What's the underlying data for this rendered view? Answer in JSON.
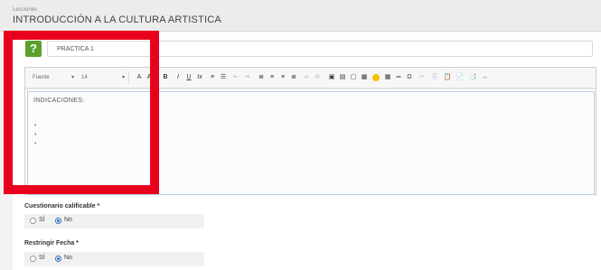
{
  "header": {
    "breadcrumb": "Lecciones",
    "title": "INTRODUCCIÓN A LA CULTURA ARTISTICA"
  },
  "question_icon": {
    "glyph": "?",
    "color": "#5aa02c"
  },
  "practice_name": {
    "value": "PRACTICA 1"
  },
  "toolbar": {
    "font_label": "Fuente",
    "size_label": "14",
    "buttons": [
      {
        "name": "font-color-icon",
        "glyph": "A"
      },
      {
        "name": "background-color-icon",
        "glyph": "A"
      },
      {
        "name": "bold-icon",
        "glyph": "B"
      },
      {
        "name": "italic-icon",
        "glyph": "I"
      },
      {
        "name": "underline-icon",
        "glyph": "U"
      },
      {
        "name": "remove-format-icon",
        "glyph": "Ix"
      },
      {
        "name": "numbered-list-icon",
        "glyph": "≡"
      },
      {
        "name": "bulleted-list-icon",
        "glyph": "☰"
      },
      {
        "name": "outdent-icon",
        "glyph": "⇤"
      },
      {
        "name": "indent-icon",
        "glyph": "⇥"
      },
      {
        "name": "align-left-icon",
        "glyph": "≣"
      },
      {
        "name": "align-center-icon",
        "glyph": "≡"
      },
      {
        "name": "align-right-icon",
        "glyph": "≡"
      },
      {
        "name": "justify-icon",
        "glyph": "≣"
      },
      {
        "name": "link-icon",
        "glyph": "∞"
      },
      {
        "name": "unlink-icon",
        "glyph": "⊘"
      },
      {
        "name": "image-icon",
        "glyph": "▣"
      },
      {
        "name": "flash-icon",
        "glyph": "▤"
      },
      {
        "name": "iframe-icon",
        "glyph": "▢"
      },
      {
        "name": "video-icon",
        "glyph": "▦"
      },
      {
        "name": "smiley-icon",
        "glyph": ""
      },
      {
        "name": "table-icon",
        "glyph": "▦"
      },
      {
        "name": "horizontal-rule-icon",
        "glyph": "═"
      },
      {
        "name": "special-char-icon",
        "glyph": "Ω"
      },
      {
        "name": "cut-icon",
        "glyph": "✂"
      },
      {
        "name": "copy-icon",
        "glyph": "⎘"
      },
      {
        "name": "paste-icon",
        "glyph": "📋"
      },
      {
        "name": "paste-text-icon",
        "glyph": "📄"
      },
      {
        "name": "paste-word-icon",
        "glyph": "📑"
      },
      {
        "name": "undo-icon",
        "glyph": "←"
      }
    ]
  },
  "editor": {
    "heading": "INDICACIONES:",
    "bullets": [
      "•",
      "•",
      "•"
    ]
  },
  "fields": [
    {
      "label": "Cuestionario calificable *",
      "options": [
        {
          "label": "SÍ",
          "checked": false
        },
        {
          "label": "No",
          "checked": true
        }
      ]
    },
    {
      "label": "Restringir Fecha *",
      "options": [
        {
          "label": "SÍ",
          "checked": false
        },
        {
          "label": "No",
          "checked": true
        }
      ]
    }
  ],
  "colors": {
    "highlight": "#e8001c",
    "accent": "#2e6db5"
  }
}
